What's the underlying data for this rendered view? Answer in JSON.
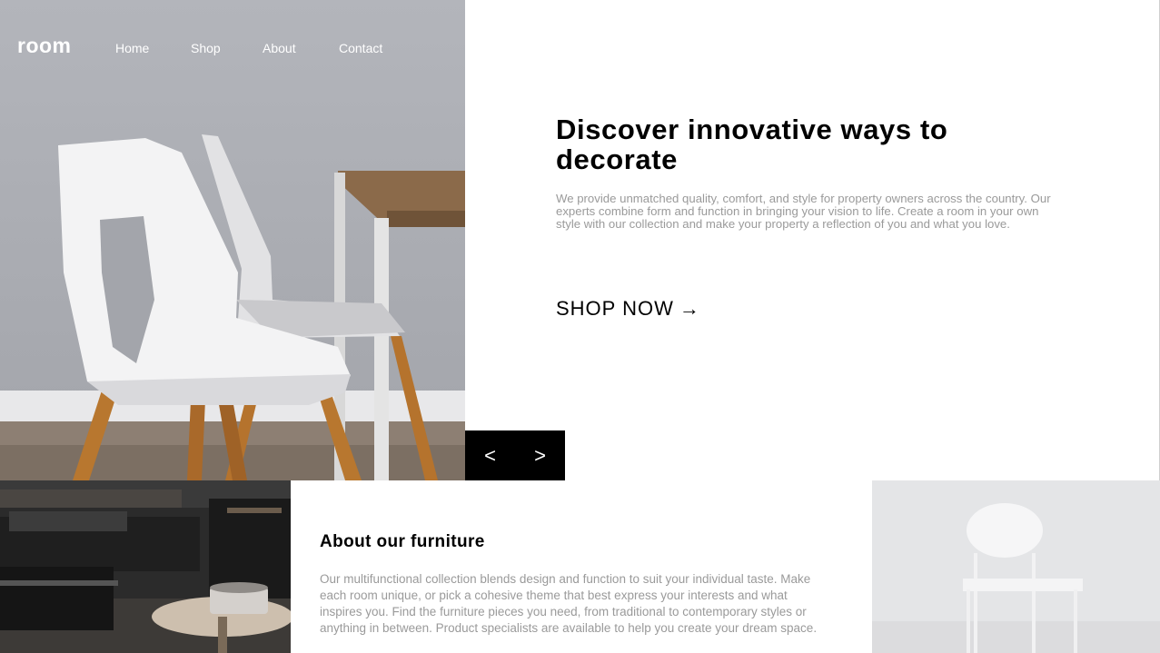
{
  "brand": {
    "logo": "room"
  },
  "nav": {
    "items": [
      {
        "label": "Home"
      },
      {
        "label": "Shop"
      },
      {
        "label": "About"
      },
      {
        "label": "Contact"
      }
    ]
  },
  "hero": {
    "title": "Discover innovative ways to decorate",
    "description": "We provide unmatched quality, comfort, and style for property owners across the country. Our experts combine form and function in bringing your vision to life. Create a room in your own style with our collection and make your property a reflection of you and what you love.",
    "cta_label": "SHOP NOW",
    "cta_arrow": "→"
  },
  "slider": {
    "prev_label": "<",
    "next_label": ">"
  },
  "about": {
    "title": "About our furniture",
    "description": "Our multifunctional collection blends design and function to suit your individual taste. Make each room unique, or pick a cohesive theme that best express your interests and what inspires you. Find the furniture pieces you need, from traditional to contemporary styles or anything in between. Product specialists are available to help you create your dream space."
  },
  "icons": {
    "arrow": "right-arrow-icon",
    "prev": "chevron-left-icon",
    "next": "chevron-right-icon"
  },
  "colors": {
    "background": "#ffffff",
    "text": "#000000",
    "muted_text": "#9a9a9a",
    "slider_bg": "#000000",
    "nav_text": "#ffffff"
  }
}
